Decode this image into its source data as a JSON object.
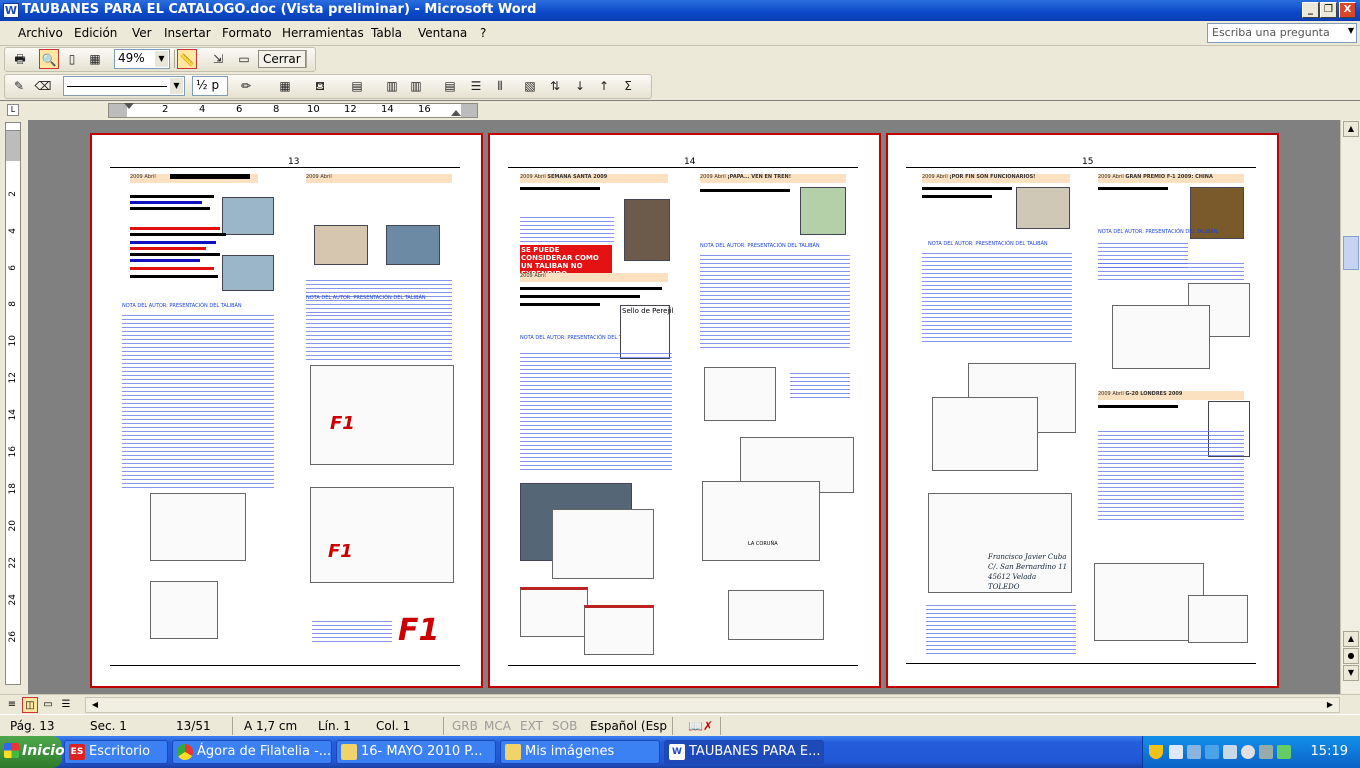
{
  "window": {
    "title": "TAUBANES PARA EL CATALOGO.doc (Vista preliminar) - Microsoft Word",
    "app_icon": "W",
    "controls": {
      "minimize": "_",
      "restore": "❐",
      "close": "X"
    }
  },
  "menu": {
    "items": [
      "Archivo",
      "Edición",
      "Ver",
      "Insertar",
      "Formato",
      "Herramientas",
      "Tabla",
      "Ventana",
      "?"
    ],
    "ask_placeholder": "Escriba una pregunta"
  },
  "toolbar1": {
    "zoom": "49%",
    "close_label": "Cerrar"
  },
  "toolbar2": {
    "line_weight": "½ p"
  },
  "ruler": {
    "numbers": [
      "2",
      "4",
      "6",
      "8",
      "10",
      "12",
      "14",
      "16"
    ]
  },
  "vruler": {
    "numbers": [
      "2",
      "4",
      "6",
      "8",
      "10",
      "12",
      "14",
      "16",
      "18",
      "20",
      "22",
      "24",
      "26"
    ]
  },
  "pages": [
    {
      "number": "13",
      "header_left": "2009 Abril",
      "header_right": "2009 Abril",
      "author_line_1": "NOTA DEL AUTOR: PRESENTACIÓN DEL TALIBÁN",
      "author_line_2": "NOTA DEL AUTOR: PRESENTACIÓN DEL TALIBÁN"
    },
    {
      "number": "14",
      "header_left": "2009 Abril",
      "heading_left": "SEMANA SANTA 2009",
      "header_right": "2009 Abril",
      "heading_right": "¡PAPÁ... VEN EN TREN!",
      "warning": "SE PUEDE CONSIDERAR COMO UN TALIBAN NO EXPENDIDO",
      "stamp_caption": "Sello de Perejil",
      "city": "LA CORUÑA",
      "author_line_1": "NOTA DEL AUTOR: PRESENTACIÓN DEL TALIBÁN",
      "author_line_2": "NOTA DEL AUTOR: PRESENTACIÓN DEL TALIBÁN"
    },
    {
      "number": "15",
      "header_left": "2009 Abril",
      "heading_left": "¡POR FIN SON FUNCIONARIOS!",
      "header_right": "2009 Abril",
      "heading_right": "GRAN PREMIO F-1 2009: CHINA",
      "heading_right_2": "G-20 LONDRES 2009",
      "author_line_1": "NOTA DEL AUTOR: PRESENTACIÓN DEL TALIBÁN",
      "author_line_2": "NOTA DEL AUTOR: PRESENTACIÓN DEL TALIBÁN",
      "handwriting": [
        "Francisco Javier Cuba",
        "C/. San Bernardino 11",
        "45612 Velada",
        "TOLEDO"
      ]
    }
  ],
  "status": {
    "page": "Pág. 13",
    "section": "Sec. 1",
    "pages": "13/51",
    "at": "A 1,7 cm",
    "line": "Lín. 1",
    "col": "Col. 1",
    "grb": "GRB",
    "mca": "MCA",
    "ext": "EXT",
    "sob": "SOB",
    "language": "Español (Esp"
  },
  "taskbar": {
    "start": "Inicio",
    "tasks": [
      "Escritorio",
      "Ágora de Filatelia -...",
      "16- MAYO 2010  P...",
      "Mis imágenes",
      "TAUBANES PARA E..."
    ],
    "clock": "15:19"
  }
}
